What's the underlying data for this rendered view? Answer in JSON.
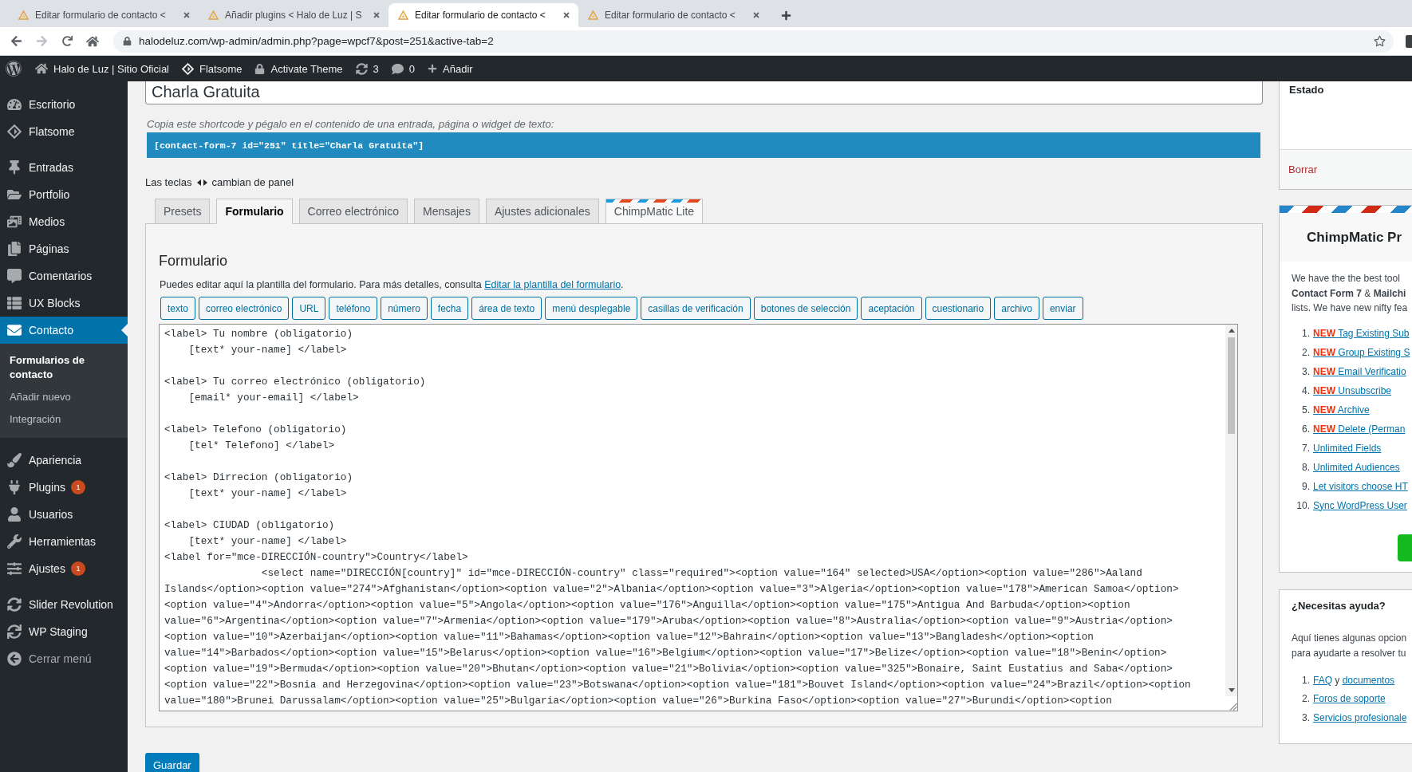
{
  "browser": {
    "tabs": [
      {
        "title": "Editar formulario de contacto <",
        "selected": false
      },
      {
        "title": "Añadir plugins < Halo de Luz | S",
        "selected": false
      },
      {
        "title": "Editar formulario de contacto <",
        "selected": true
      },
      {
        "title": "Editar formulario de contacto <",
        "selected": false
      }
    ],
    "url": "halodeluz.com/wp-admin/admin.php?page=wpcf7&post=251&active-tab=2"
  },
  "admin_bar": {
    "items": [
      {
        "label": "Halo de Luz | Sitio Oficial"
      },
      {
        "label": "Flatsome"
      },
      {
        "label": "Activate Theme"
      },
      {
        "label": "3"
      },
      {
        "label": "0"
      },
      {
        "label": "Añadir"
      }
    ]
  },
  "sidebar": {
    "groups": [
      [
        {
          "label": "Escritorio",
          "selected": false,
          "kind": "link"
        },
        {
          "label": "Flatsome",
          "selected": false,
          "kind": "link"
        }
      ],
      [
        {
          "label": "Entradas",
          "selected": false,
          "kind": "link"
        },
        {
          "label": "Portfolio",
          "selected": false,
          "kind": "link"
        },
        {
          "label": "Medios",
          "selected": false,
          "kind": "link"
        },
        {
          "label": "Páginas",
          "selected": false,
          "kind": "link"
        },
        {
          "label": "Comentarios",
          "selected": false,
          "kind": "link"
        },
        {
          "label": "UX Blocks",
          "selected": false,
          "kind": "link"
        },
        {
          "label": "Contacto",
          "selected": true,
          "kind": "link",
          "children": [
            {
              "label": "Formularios de contacto",
              "selected": true
            },
            {
              "label": "Añadir nuevo",
              "selected": false
            },
            {
              "label": "Integración",
              "selected": false
            }
          ]
        }
      ],
      [
        {
          "label": "Apariencia",
          "selected": false,
          "kind": "link"
        },
        {
          "label": "Plugins",
          "selected": false,
          "kind": "link",
          "badge": "1"
        },
        {
          "label": "Usuarios",
          "selected": false,
          "kind": "link"
        },
        {
          "label": "Herramientas",
          "selected": false,
          "kind": "link"
        },
        {
          "label": "Ajustes",
          "selected": false,
          "kind": "link",
          "badge": "1"
        }
      ],
      [
        {
          "label": "Slider Revolution",
          "selected": false,
          "kind": "link"
        },
        {
          "label": "WP Staging",
          "selected": false,
          "kind": "link"
        },
        {
          "label": "Cerrar menú",
          "selected": false,
          "kind": "collapse"
        }
      ]
    ]
  },
  "form": {
    "title_value": "Charla Gratuita",
    "shortcode_hint": "Copia este shortcode y pégalo en el contenido de una entrada, página o widget de texto:",
    "shortcode": "[contact-form-7 id=\"251\" title=\"Charla Gratuita\"]",
    "keys_hint": {
      "before": "Las teclas",
      "after": "cambian de panel"
    },
    "tabs": [
      {
        "label": "Presets",
        "selected": false,
        "kind": "plain"
      },
      {
        "label": "Formulario",
        "selected": true,
        "kind": "plain"
      },
      {
        "label": "Correo electrónico",
        "selected": false,
        "kind": "plain"
      },
      {
        "label": "Mensajes",
        "selected": false,
        "kind": "plain"
      },
      {
        "label": "Ajustes adicionales",
        "selected": false,
        "kind": "plain"
      },
      {
        "label": "ChimpMatic Lite",
        "selected": false,
        "kind": "airmail"
      }
    ],
    "panel": {
      "heading": "Formulario",
      "description": "Puedes editar aquí la plantilla del formulario. Para más detalles, consulta",
      "link": "Editar la plantilla del formulario",
      "description_end": ".",
      "tag_buttons": [
        "texto",
        "correo electrónico",
        "URL",
        "teléfono",
        "número",
        "fecha",
        "área de texto",
        "menú desplegable",
        "casillas de verificación",
        "botones de selección",
        "aceptación",
        "cuestionario",
        "archivo",
        "enviar"
      ],
      "template": "<label> Tu nombre (obligatorio)\n    [text* your-name] </label>\n\n<label> Tu correo electrónico (obligatorio)\n    [email* your-email] </label>\n\n<label> Telefono (obligatorio)\n    [tel* Telefono] </label>\n\n<label> Dirrecion (obligatorio)\n    [text* your-name] </label>\n\n<label> CIUDAD (obligatorio)\n    [text* your-name] </label>\n<label for=\"mce-DIRECCIÓN-country\">Country</label>\n                <select name=\"DIRECCIÓN[country]\" id=\"mce-DIRECCIÓN-country\" class=\"required\"><option value=\"164\" selected>USA</option><option value=\"286\">Aaland\nIslands</option><option value=\"274\">Afghanistan</option><option value=\"2\">Albania</option><option value=\"3\">Algeria</option><option value=\"178\">American Samoa</option>\n<option value=\"4\">Andorra</option><option value=\"5\">Angola</option><option value=\"176\">Anguilla</option><option value=\"175\">Antigua And Barbuda</option><option\nvalue=\"6\">Argentina</option><option value=\"7\">Armenia</option><option value=\"179\">Aruba</option><option value=\"8\">Australia</option><option value=\"9\">Austria</option>\n<option value=\"10\">Azerbaijan</option><option value=\"11\">Bahamas</option><option value=\"12\">Bahrain</option><option value=\"13\">Bangladesh</option><option\nvalue=\"14\">Barbados</option><option value=\"15\">Belarus</option><option value=\"16\">Belgium</option><option value=\"17\">Belize</option><option value=\"18\">Benin</option>\n<option value=\"19\">Bermuda</option><option value=\"20\">Bhutan</option><option value=\"21\">Bolivia</option><option value=\"325\">Bonaire, Saint Eustatius and Saba</option>\n<option value=\"22\">Bosnia and Herzegovina</option><option value=\"23\">Botswana</option><option value=\"181\">Bouvet Island</option><option value=\"24\">Brazil</option><option\nvalue=\"180\">Brunei Darussalam</option><option value=\"25\">Bulgaria</option><option value=\"26\">Burkina Faso</option><option value=\"27\">Burundi</option><option"
    },
    "save_button": "Guardar"
  },
  "status_box": {
    "title": "Estado",
    "delete_link": "Borrar"
  },
  "chimpmatic_box": {
    "title": "ChimpMatic Pr",
    "intro_lines": [
      "We have the the best tool",
      "**Contact Form 7** & **Mailchi**",
      "lists. We have new nifty fea"
    ],
    "features": [
      {
        "number": "1.",
        "tag": "NEW",
        "label": "Tag Existing Sub"
      },
      {
        "number": "2.",
        "tag": "NEW",
        "label": "Group Existing S"
      },
      {
        "number": "3.",
        "tag": "NEW",
        "label": "Email Verificatio"
      },
      {
        "number": "4.",
        "tag": "NEW",
        "label": "Unsubscribe"
      },
      {
        "number": "5.",
        "tag": "NEW",
        "label": "Archive"
      },
      {
        "number": "6.",
        "tag": "NEW",
        "label": "Delete (Perman"
      },
      {
        "number": "7.",
        "label": "Unlimited Fields"
      },
      {
        "number": "8.",
        "label": "Unlimited Audiences"
      },
      {
        "number": "9.",
        "label": "Let visitors choose HT"
      },
      {
        "number": "10.",
        "label": "Sync WordPress User"
      }
    ]
  },
  "help_box": {
    "title": "¿Necesitas ayuda?",
    "intro_lines": [
      "Aquí tienes algunas opcion",
      "para ayudarte a resolver tu"
    ],
    "items": [
      {
        "number": "1.",
        "links": [
          "FAQ",
          "documentos"
        ],
        "joiner": "y"
      },
      {
        "number": "2.",
        "links": [
          "Foros de soporte"
        ]
      },
      {
        "number": "3.",
        "links": [
          "Servicios profesionale"
        ]
      }
    ]
  }
}
